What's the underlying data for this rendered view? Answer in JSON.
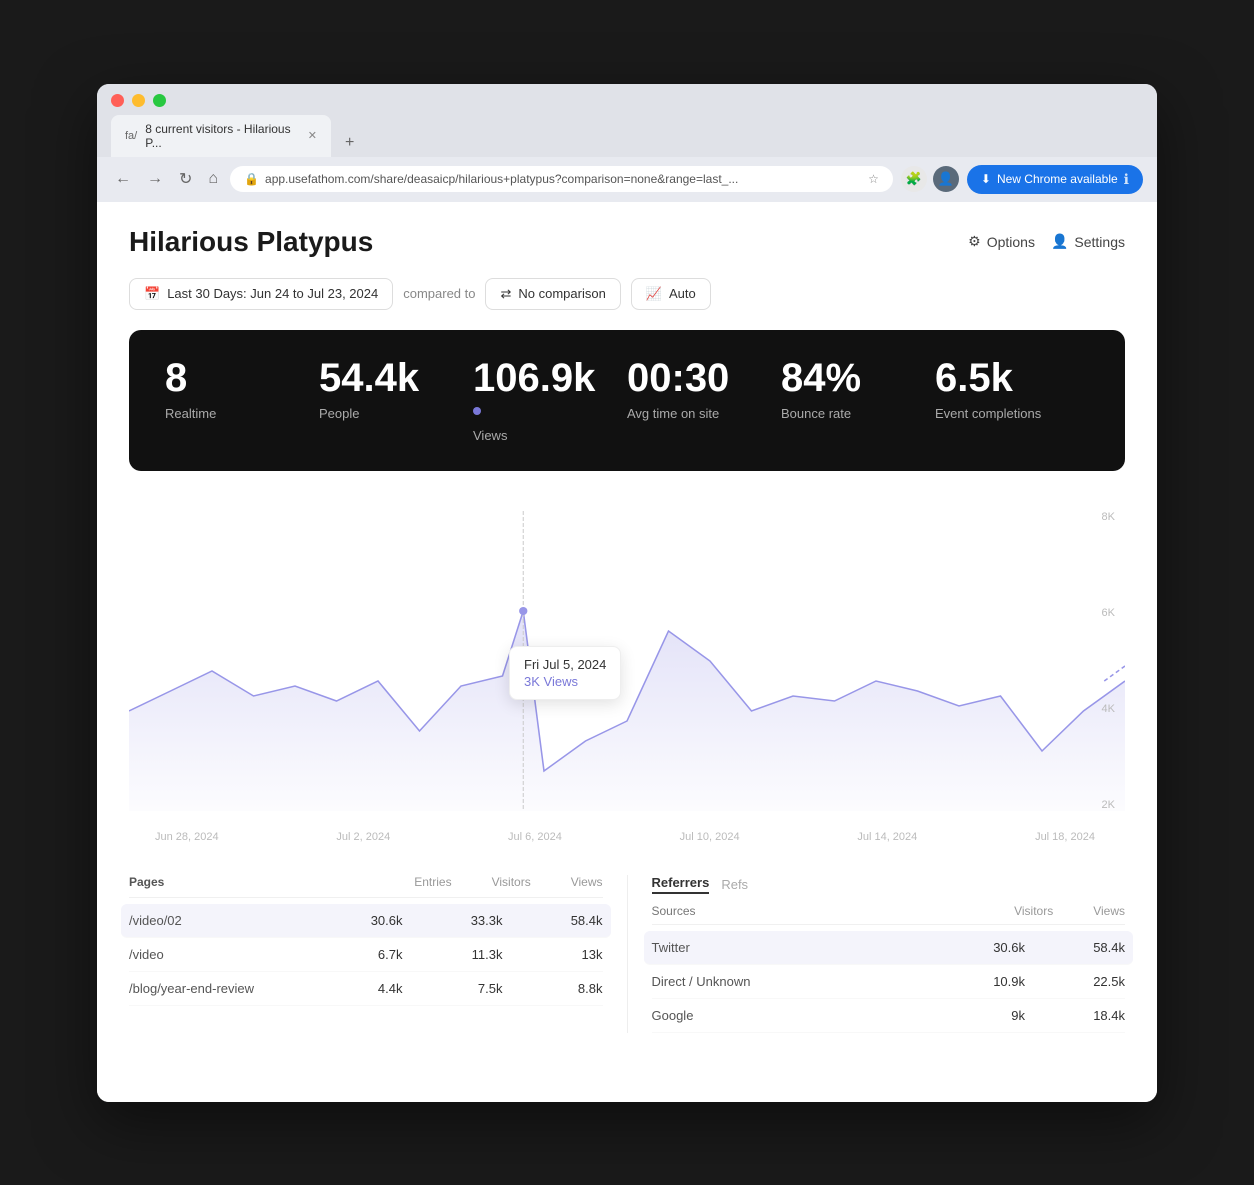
{
  "browser": {
    "tab_label": "8 current visitors - Hilarious P...",
    "tab_new_label": "+",
    "url": "app.usefathom.com/share/deasaicp/hilarious+platypus?comparison=none&range=last_...",
    "chrome_available": "New Chrome available",
    "nav_back": "←",
    "nav_forward": "→",
    "nav_refresh": "↻",
    "nav_home": "⌂",
    "fa_label": "fa/"
  },
  "page": {
    "title": "Hilarious Platypus",
    "options_label": "Options",
    "settings_label": "Settings"
  },
  "filters": {
    "date_range": "Last 30 Days: Jun 24 to Jul 23, 2024",
    "compared_to": "compared to",
    "comparison_label": "No comparison",
    "auto_label": "Auto"
  },
  "stats": {
    "realtime_value": "8",
    "realtime_label": "Realtime",
    "people_value": "54.4k",
    "people_label": "People",
    "views_value": "106.9k",
    "views_label": "Views",
    "avg_time_value": "00:30",
    "avg_time_label": "Avg time on site",
    "bounce_value": "84%",
    "bounce_label": "Bounce rate",
    "events_value": "6.5k",
    "events_label": "Event completions"
  },
  "chart": {
    "tooltip_date": "Fri Jul 5, 2024",
    "tooltip_views": "3K Views",
    "x_labels": [
      "Jun 28, 2024",
      "Jul 2, 2024",
      "Jul 6, 2024",
      "Jul 10, 2024",
      "Jul 14, 2024",
      "Jul 18, 2024"
    ],
    "y_labels": [
      "8K",
      "6K",
      "4K",
      "2K"
    ]
  },
  "pages_table": {
    "col_page": "Pages",
    "col_entries": "Entries",
    "col_visitors": "Visitors",
    "col_views": "Views",
    "rows": [
      {
        "page": "/video/02",
        "entries": "30.6k",
        "visitors": "33.3k",
        "views": "58.4k",
        "highlighted": true
      },
      {
        "page": "/video",
        "entries": "6.7k",
        "visitors": "11.3k",
        "views": "13k",
        "highlighted": false
      },
      {
        "page": "/blog/year-end-review",
        "entries": "4.4k",
        "visitors": "7.5k",
        "views": "8.8k",
        "highlighted": false
      }
    ]
  },
  "referrers": {
    "tab_referrers": "Referrers",
    "tab_refs": "Refs",
    "sub_label": "Sources",
    "col_visitors": "Visitors",
    "col_views": "Views",
    "rows": [
      {
        "source": "Twitter",
        "visitors": "30.6k",
        "views": "58.4k",
        "highlighted": true
      },
      {
        "source": "Direct / Unknown",
        "visitors": "10.9k",
        "views": "22.5k",
        "highlighted": false
      },
      {
        "source": "Google",
        "visitors": "9k",
        "views": "18.4k",
        "highlighted": false
      }
    ]
  }
}
